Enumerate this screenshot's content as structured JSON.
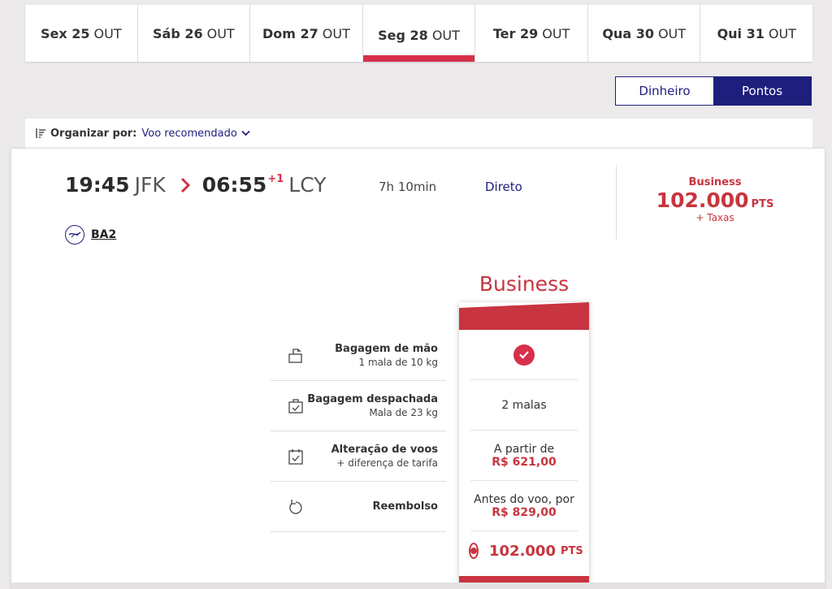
{
  "date_tabs": [
    {
      "day": "Sex 25",
      "month": "OUT",
      "active": false
    },
    {
      "day": "Sáb 26",
      "month": "OUT",
      "active": false
    },
    {
      "day": "Dom 27",
      "month": "OUT",
      "active": false
    },
    {
      "day": "Seg 28",
      "month": "OUT",
      "active": true
    },
    {
      "day": "Ter 29",
      "month": "OUT",
      "active": false
    },
    {
      "day": "Qua 30",
      "month": "OUT",
      "active": false
    },
    {
      "day": "Qui 31",
      "month": "OUT",
      "active": false
    }
  ],
  "currency_toggle": {
    "money_label": "Dinheiro",
    "points_label": "Pontos",
    "selected": "Pontos"
  },
  "sort": {
    "label": "Organizar por:",
    "value": "Voo recomendado"
  },
  "flight": {
    "depart_time": "19:45",
    "depart_airport": "JFK",
    "arrive_time": "06:55",
    "day_offset": "+1",
    "arrive_airport": "LCY",
    "duration": "7h 10min",
    "stops": "Direto",
    "flight_number": "BA2"
  },
  "price_summary": {
    "cabin": "Business",
    "amount": "102.000",
    "unit": "PTS",
    "taxes": "+ Taxas"
  },
  "fare": {
    "title": "Business",
    "baggage_cabin": "included",
    "baggage_checked": "2 malas",
    "change_prefix": "A partir de",
    "change_price": "R$ 621,00",
    "refund_prefix": "Antes do voo, por",
    "refund_price": "R$ 829,00",
    "select_amount": "102.000",
    "select_unit": "PTS"
  },
  "features": [
    {
      "title": "Bagagem de mão",
      "sub": "1 mala de 10 kg",
      "icon": "carry-on-bag-icon"
    },
    {
      "title": "Bagagem despachada",
      "sub": "Mala de 23 kg",
      "icon": "checked-bag-icon"
    },
    {
      "title": "Alteração de voos",
      "sub": "+ diferença de tarifa",
      "icon": "calendar-check-icon"
    },
    {
      "title": "Reembolso",
      "sub": "",
      "icon": "refund-icon"
    }
  ],
  "colors": {
    "brand_red": "#c8343f",
    "tab_accent": "#d6304a",
    "navy": "#1e1e7d"
  }
}
